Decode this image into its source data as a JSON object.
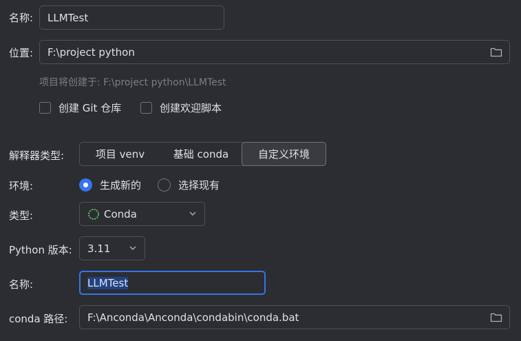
{
  "name": {
    "label": "名称:",
    "value": "LLMTest"
  },
  "location": {
    "label": "位置:",
    "value": "F:\\project python",
    "icon": "folder-icon"
  },
  "hint": "项目将创建于: F:\\project python\\LLMTest",
  "checkboxes": [
    {
      "label": "创建 Git 仓库",
      "checked": false
    },
    {
      "label": "创建欢迎脚本",
      "checked": false
    }
  ],
  "interpreter": {
    "label": "解释器类型:",
    "options": [
      "项目 venv",
      "基础 conda",
      "自定义环境"
    ],
    "selected": "自定义环境"
  },
  "environment": {
    "label": "环境:",
    "options": [
      {
        "label": "生成新的",
        "selected": true
      },
      {
        "label": "选择现有",
        "selected": false
      }
    ]
  },
  "type": {
    "label": "类型:",
    "value": "Conda",
    "icon": "conda-spinner-icon"
  },
  "python_version": {
    "label": "Python 版本:",
    "value": "3.11"
  },
  "env_name": {
    "label": "名称:",
    "value": "LLMTest"
  },
  "conda_path": {
    "label": "conda 路径:",
    "value": "F:\\Anconda\\Anconda\\condabin\\conda.bat",
    "icon": "folder-icon"
  },
  "colors": {
    "background": "#2b2d30",
    "accent": "#3574f0",
    "border": "#4e5157",
    "text": "#dfe1e5",
    "hint": "#7a7e85",
    "conda_icon": "#5fb85f"
  }
}
